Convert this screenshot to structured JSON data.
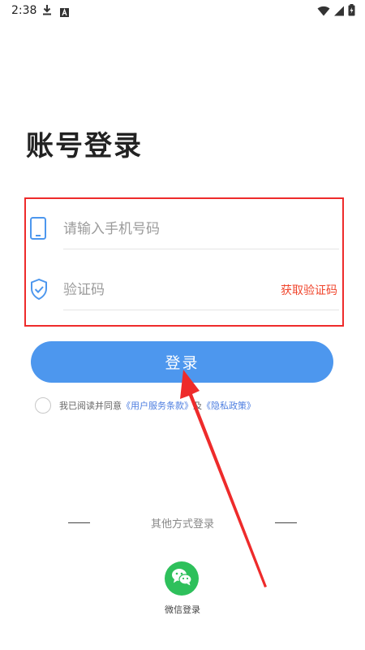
{
  "status_bar": {
    "time": "2:38"
  },
  "title": "账号登录",
  "phone": {
    "placeholder": "请输入手机号码",
    "value": ""
  },
  "code": {
    "placeholder": "验证码",
    "value": "",
    "get_code": "获取验证码"
  },
  "login_button": "登录",
  "agreement": {
    "prefix": "我已阅读并同意",
    "terms": "《用户服务条款》",
    "and": "及",
    "privacy": "《隐私政策》"
  },
  "other_login": "其他方式登录",
  "wechat_label": "微信登录",
  "colors": {
    "primary": "#4d97ee",
    "accent_red": "#f0452c",
    "wechat": "#2ec05b",
    "annotation": "#ee2b2b"
  }
}
